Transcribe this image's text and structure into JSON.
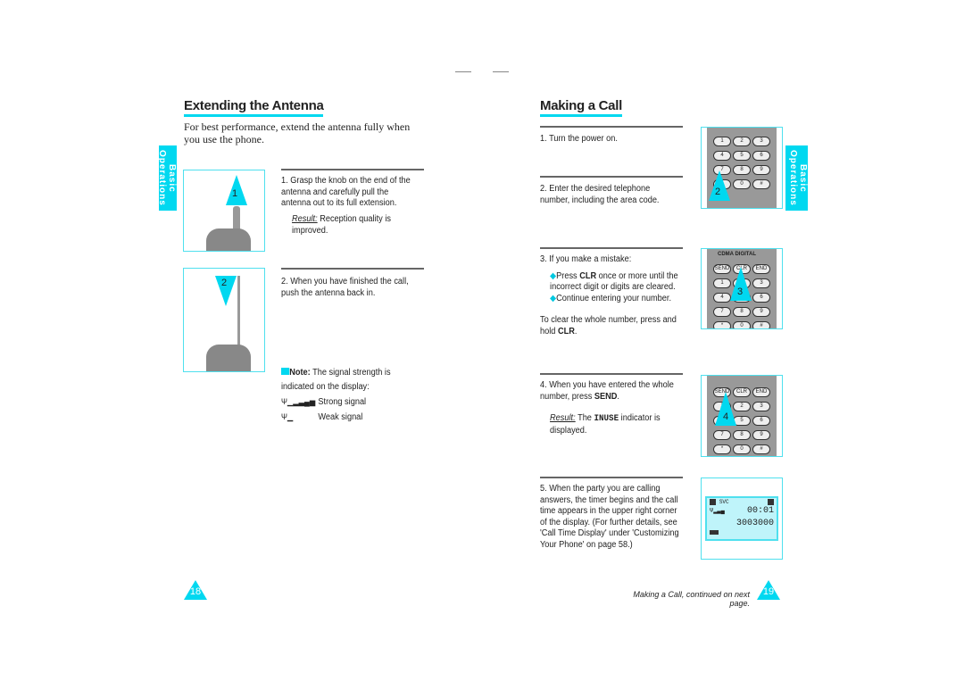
{
  "left": {
    "title": "Extending the Antenna",
    "intro": "For best performance, extend the antenna fully when you use the phone.",
    "tab": "Basic Operations",
    "step1": {
      "text": "1. Grasp the knob on the end of the antenna and carefully pull the antenna out to its full extension.",
      "result_label": "Result:",
      "result": "Reception quality is improved.",
      "marker": "1"
    },
    "step2": {
      "text": "2. When you have finished the call, push the antenna back in.",
      "marker": "2"
    },
    "note": {
      "label": "Note:",
      "text": "The signal strength is indicated on the display:",
      "strong": "Strong signal",
      "weak": "Weak signal"
    },
    "page": "18"
  },
  "right": {
    "title": "Making a Call",
    "tab": "Basic Operations",
    "step1": "1. Turn the power on.",
    "step2": {
      "text": "2. Enter the desired telephone number, including the area code.",
      "marker": "2"
    },
    "step3": {
      "text": "3. If you make a mistake:",
      "b1_pre": "Press ",
      "b1_bold": "CLR",
      "b1_post": " once or more until the incorrect digit or digits are cleared.",
      "b2": "Continue entering your number.",
      "clear_pre": "To clear the whole number, press and hold ",
      "clear_bold": "CLR",
      "clear_post": ".",
      "marker": "3"
    },
    "step4": {
      "pre": "4. When you have entered the whole number, press ",
      "bold": "SEND",
      "post": ".",
      "result_label": "Result:",
      "r_pre": "The ",
      "r_bold": "INUSE",
      "r_post": " indicator is displayed.",
      "marker": "4"
    },
    "step5": "5. When the party you are calling answers, the timer begins and the call time appears in the upper right corner of the display. (For further details, see 'Call Time Display' under 'Customizing Your Phone' on page 58.)",
    "display": {
      "svc": "SVC",
      "time": "00:01",
      "number": "3003000"
    },
    "brand": "CDMA DIGITAL",
    "keys": {
      "send": "SEND",
      "clr": "CLR",
      "end": "END"
    },
    "continued": "Making a Call, continued on next page.",
    "page": "19"
  },
  "colors": {
    "accent": "#00d8f0"
  }
}
